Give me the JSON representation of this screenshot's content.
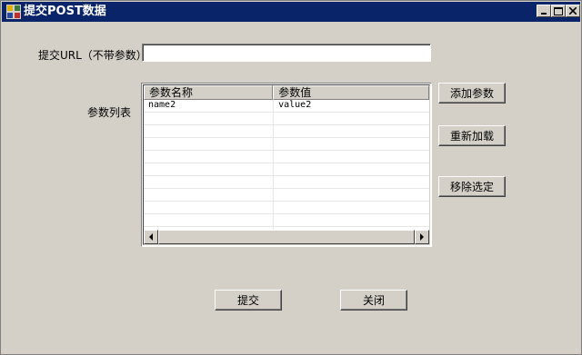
{
  "window": {
    "title": "提交POST数据",
    "controls": {
      "minimize": "minimize-icon",
      "maximize": "maximize-icon",
      "close": "close-icon"
    }
  },
  "form": {
    "url_label": "提交URL（不带参数）",
    "url_value": "",
    "params_label": "参数列表"
  },
  "table": {
    "columns": [
      "参数名称",
      "参数值"
    ],
    "rows": [
      {
        "name": "name2",
        "value": "value2"
      }
    ]
  },
  "side_buttons": {
    "add": "添加参数",
    "reload": "重新加载",
    "remove": "移除选定"
  },
  "bottom_buttons": {
    "submit": "提交",
    "close": "关闭"
  }
}
